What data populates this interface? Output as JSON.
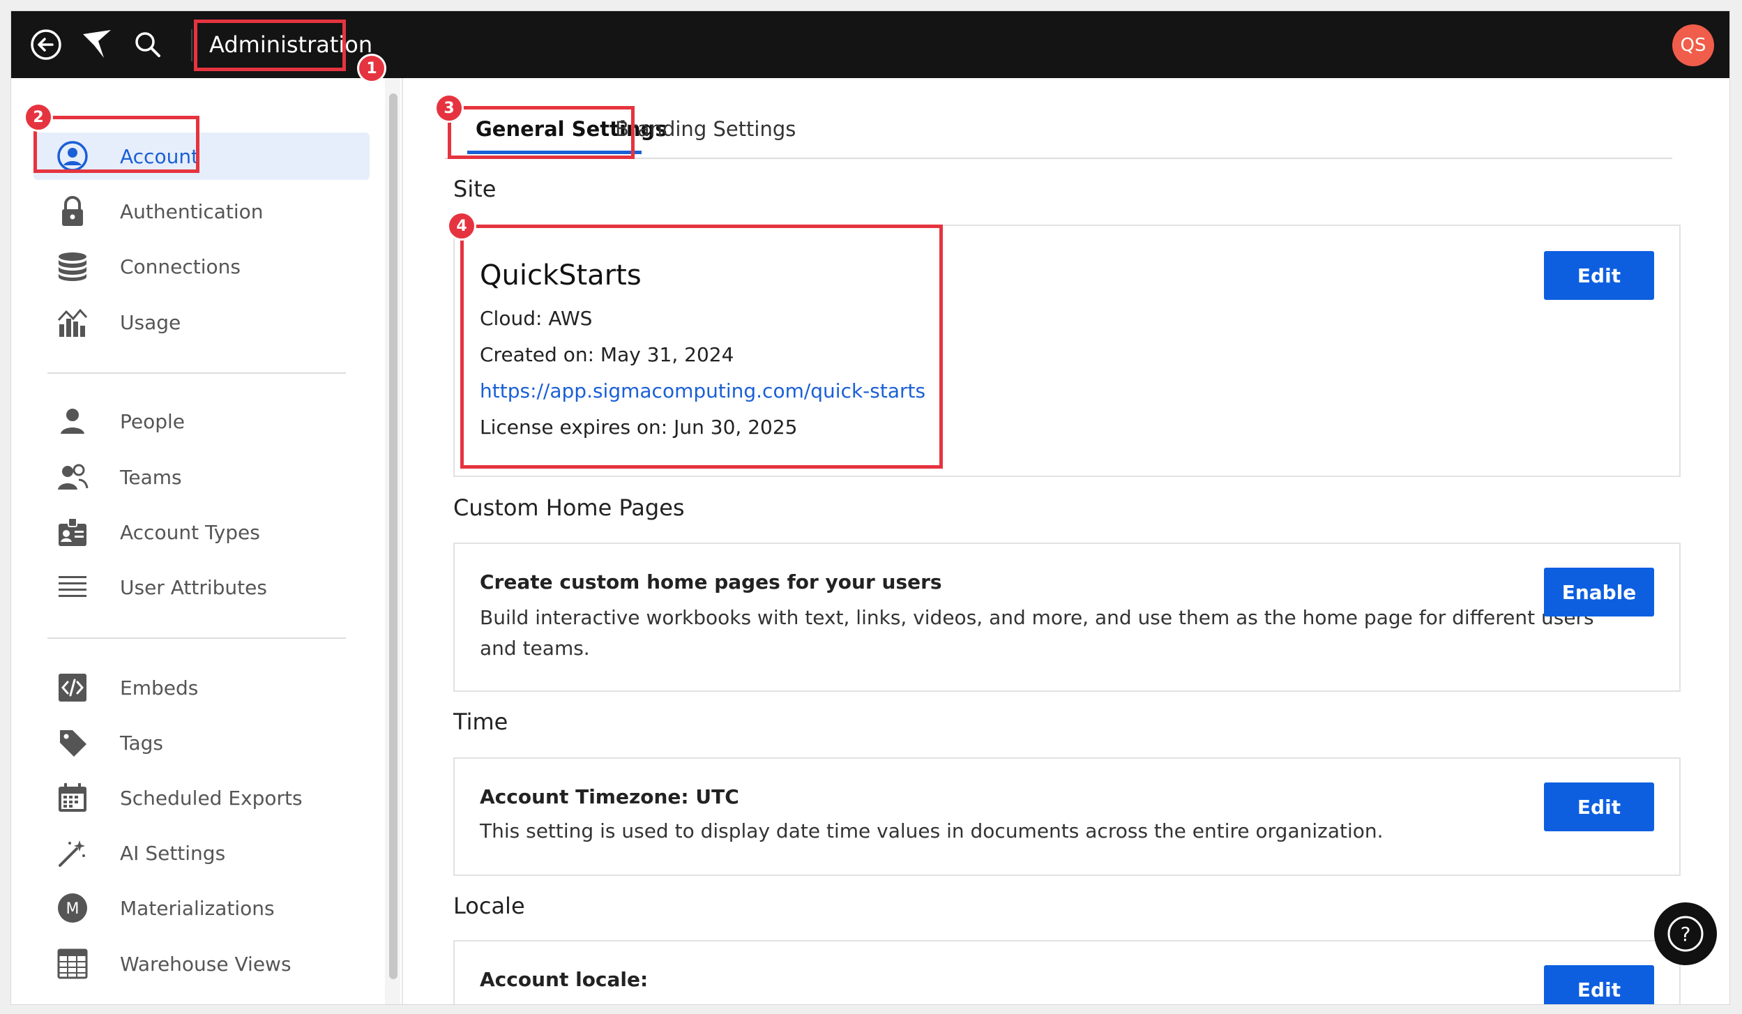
{
  "topbar": {
    "title": "Administration",
    "avatar_initials": "QS",
    "icons": [
      "back-arrow-icon",
      "sigma-logo-icon",
      "search-icon"
    ]
  },
  "sidebar": {
    "items": [
      {
        "label": "Account",
        "icon": "account-circle-icon",
        "active": true
      },
      {
        "label": "Authentication",
        "icon": "lock-icon"
      },
      {
        "label": "Connections",
        "icon": "database-icon"
      },
      {
        "label": "Usage",
        "icon": "usage-chart-icon"
      },
      {
        "label": "People",
        "icon": "person-icon"
      },
      {
        "label": "Teams",
        "icon": "team-icon"
      },
      {
        "label": "Account Types",
        "icon": "id-badge-icon"
      },
      {
        "label": "User Attributes",
        "icon": "list-icon"
      },
      {
        "label": "Embeds",
        "icon": "code-icon"
      },
      {
        "label": "Tags",
        "icon": "tag-icon"
      },
      {
        "label": "Scheduled Exports",
        "icon": "calendar-icon"
      },
      {
        "label": "AI Settings",
        "icon": "magic-wand-icon"
      },
      {
        "label": "Materializations",
        "icon": "materialization-m-icon"
      },
      {
        "label": "Warehouse Views",
        "icon": "grid-table-icon"
      }
    ]
  },
  "tabs": {
    "general": "General Settings",
    "branding": "Branding Settings"
  },
  "site": {
    "section_title": "Site",
    "name": "QuickStarts",
    "cloud": "Cloud: AWS",
    "created": "Created on: May 31, 2024",
    "url": "https://app.sigmacomputing.com/quick-starts",
    "license": "License expires on: Jun 30, 2025",
    "edit_label": "Edit"
  },
  "home_pages": {
    "section_title": "Custom Home Pages",
    "heading": "Create custom home pages for your users",
    "description_line1": "Build interactive workbooks with text, links, videos, and more, and use them as the home page for different users",
    "description_line2": "and teams.",
    "enable_label": "Enable"
  },
  "time": {
    "section_title": "Time",
    "heading": "Account Timezone: UTC",
    "description": "This setting is used to display date time values in documents across the entire organization.",
    "edit_label": "Edit"
  },
  "locale": {
    "section_title": "Locale",
    "heading": "Account locale:",
    "edit_label": "Edit"
  },
  "callouts": [
    "1",
    "2",
    "3",
    "4"
  ],
  "colors": {
    "topbar": "#141414",
    "accent": "#0d5fe0",
    "callout": "#e5343f",
    "avatar": "#f05d4a"
  }
}
